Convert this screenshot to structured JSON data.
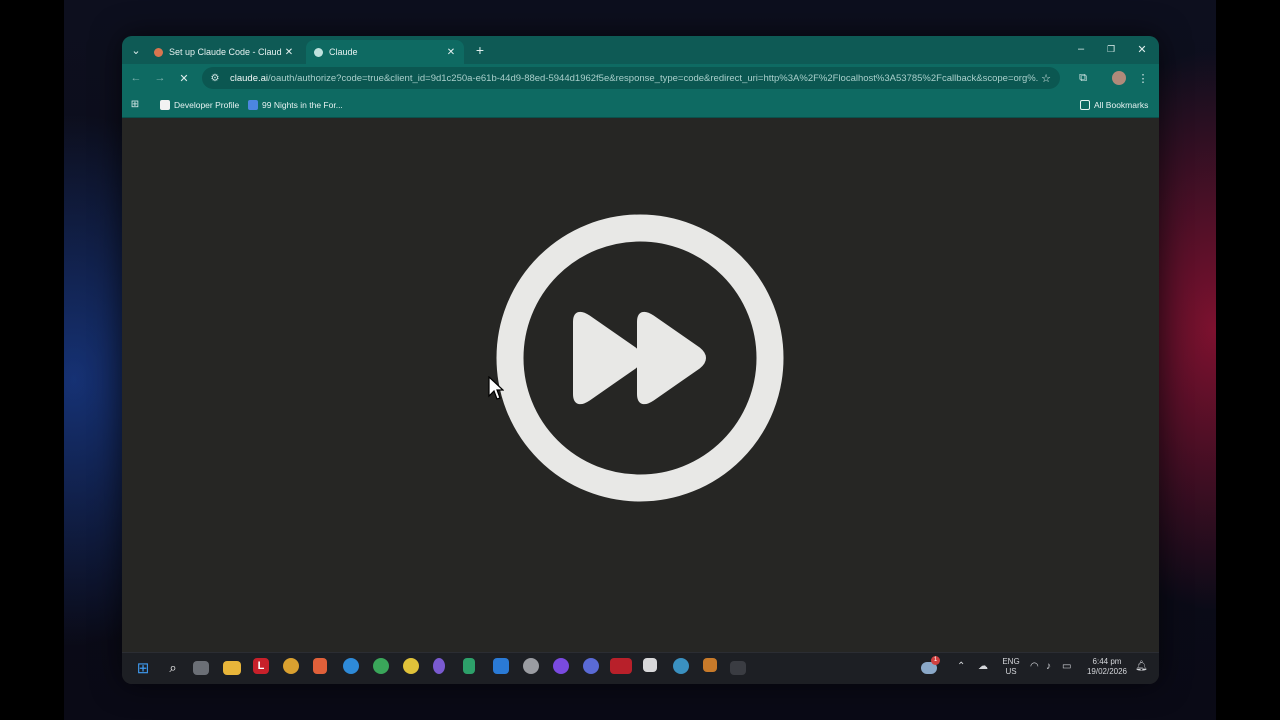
{
  "browser": {
    "tabs": [
      {
        "title": "Set up Claude Code - Claude C",
        "active": false,
        "favicon_color": "#d9754f"
      },
      {
        "title": "Claude",
        "active": true,
        "favicon_color": "#bfe2de"
      }
    ],
    "address": {
      "host": "claude.ai",
      "path": "/oauth/authorize?code=true&client_id=9d1c250a-e61b-44d9-88ed-5944d1962f5e&response_type=code&redirect_uri=http%3A%2F%2Flocalhost%3A53785%2Fcallback&scope=org%..."
    },
    "bookmarks": [
      {
        "label": "Developer Profile",
        "icon": "roblox-icon"
      },
      {
        "label": "99 Nights in the For...",
        "icon": "roblox-icon"
      }
    ],
    "all_bookmarks_label": "All Bookmarks"
  },
  "content": {
    "overlay_icon": "fast-forward-icon"
  },
  "taskbar": {
    "language": {
      "line1": "ENG",
      "line2": "US"
    },
    "time": "6:44 pm",
    "date": "19/02/2026",
    "weather_badge": "1"
  },
  "colors": {
    "chrome_theme": "#0e6a62",
    "page_background": "#262624",
    "icon_color": "#e8e8e6"
  }
}
